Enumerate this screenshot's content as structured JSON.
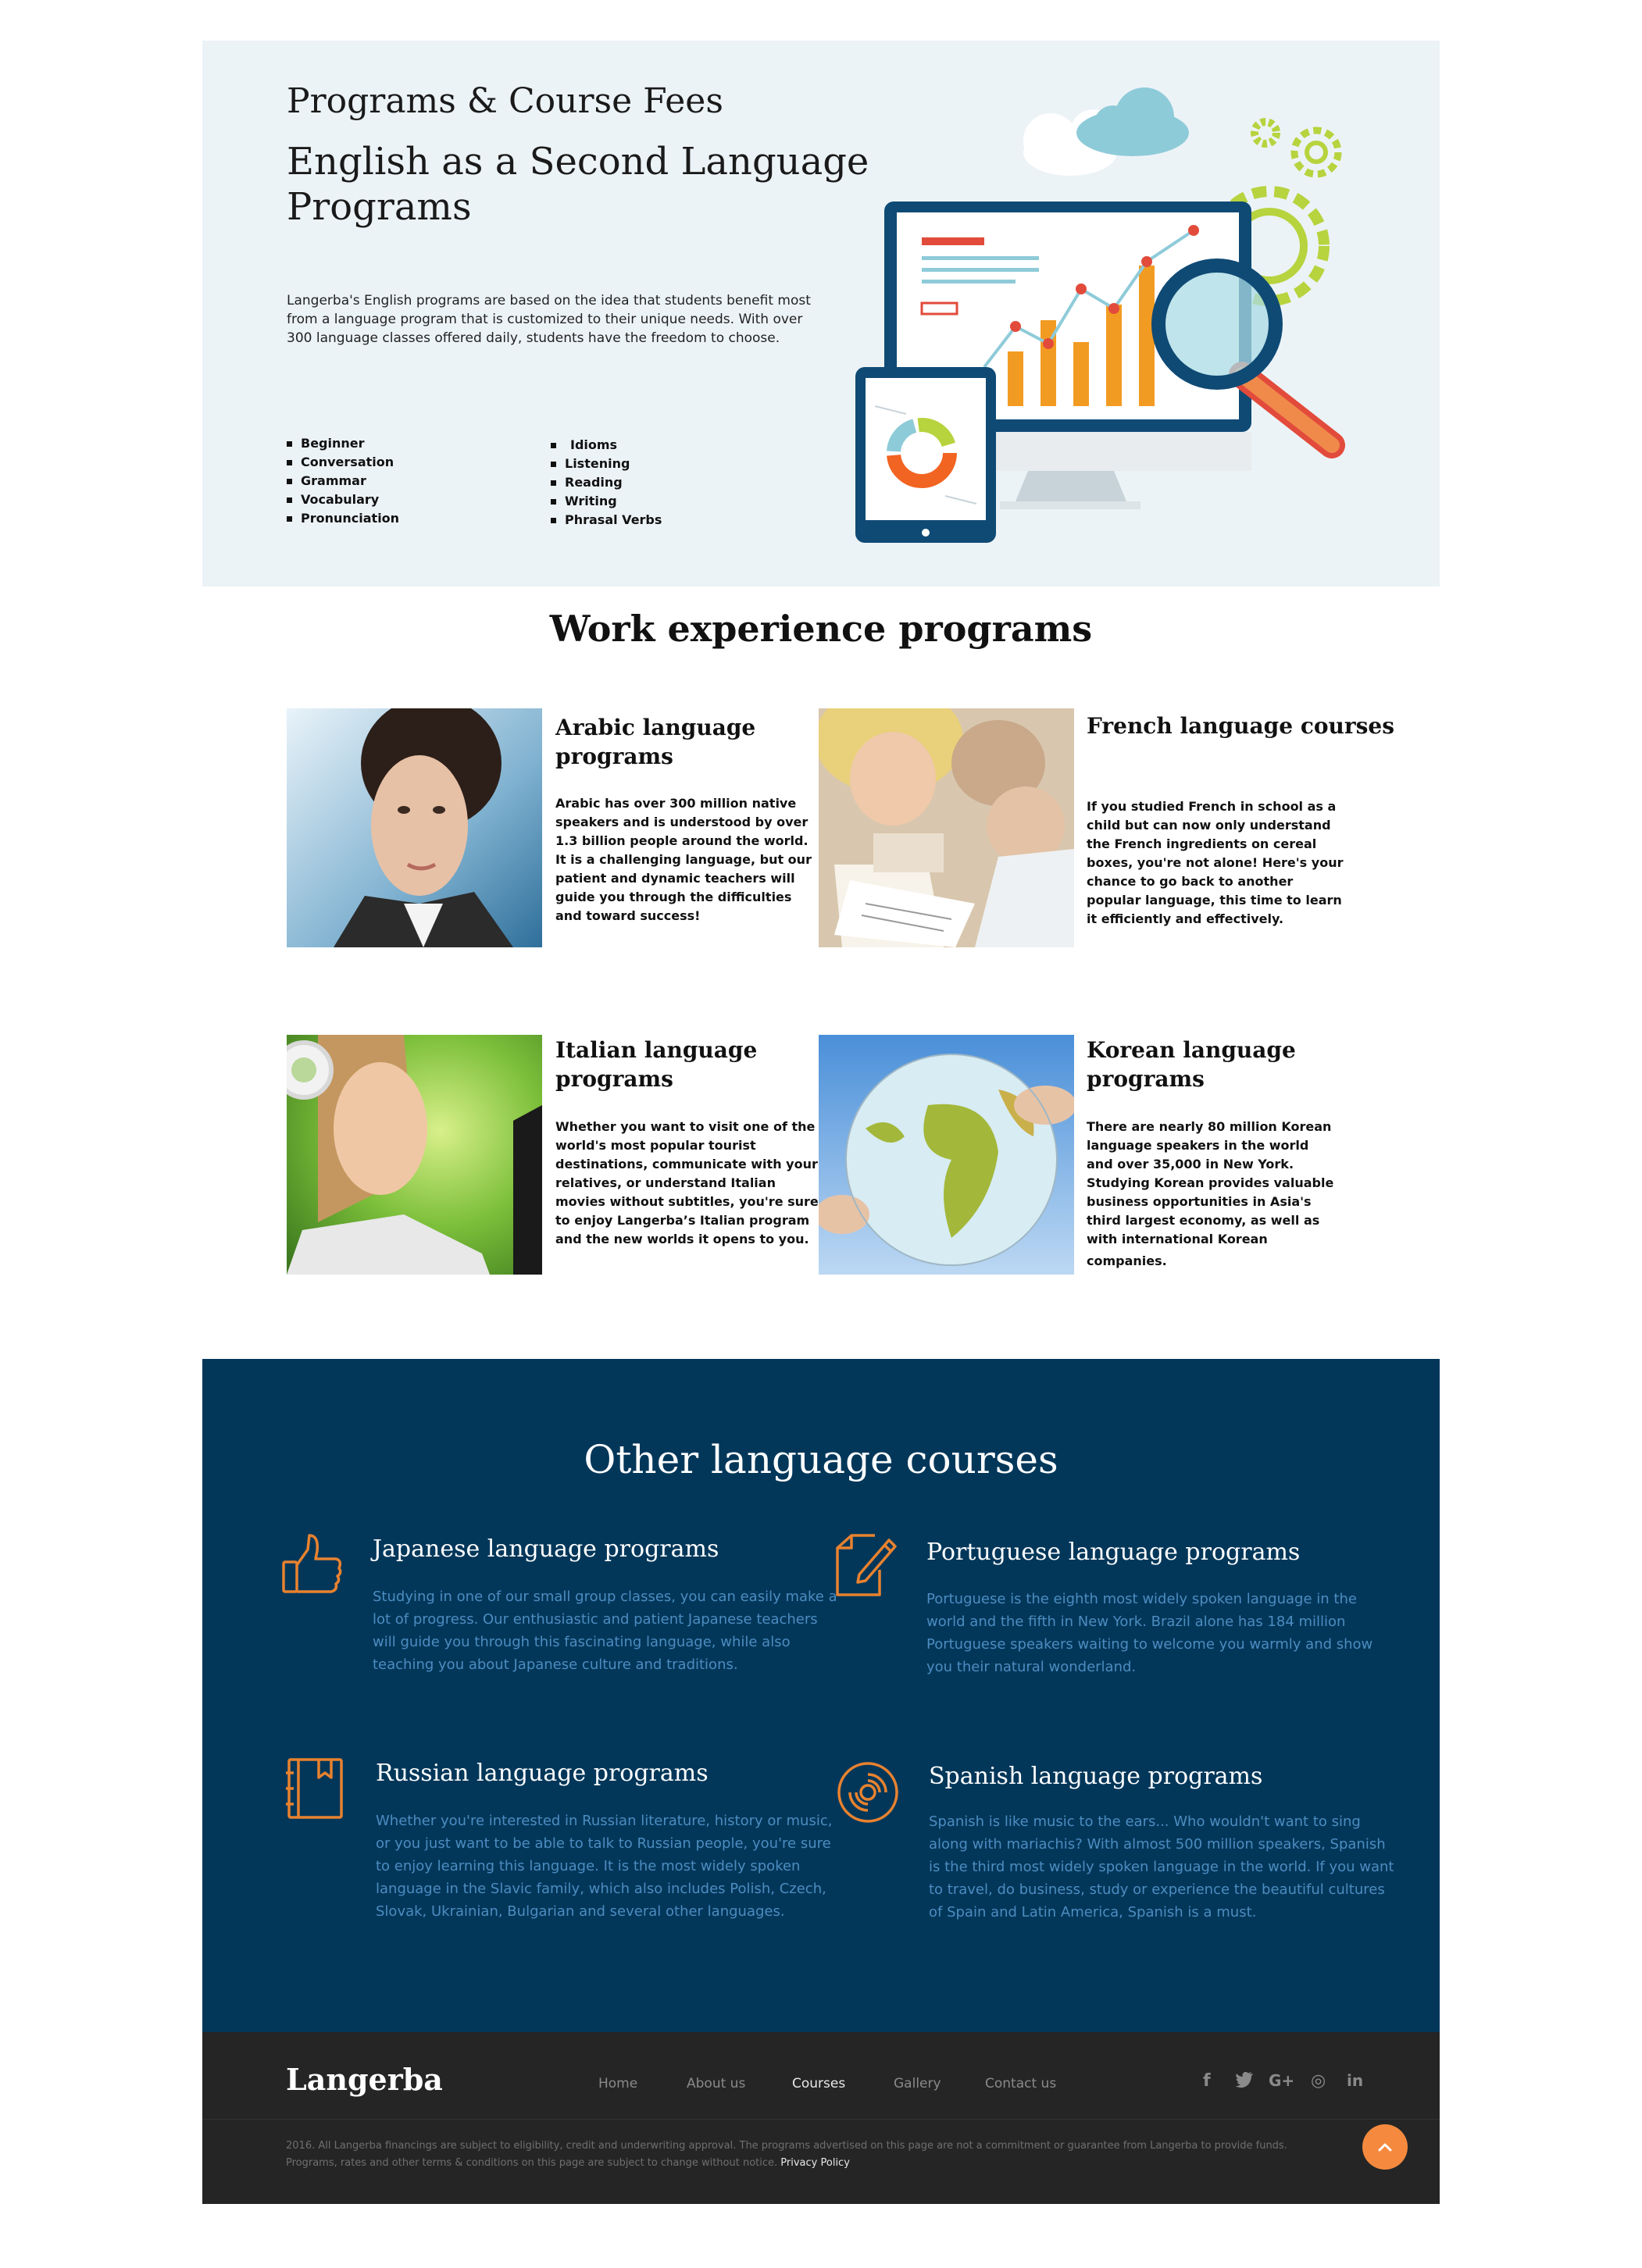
{
  "hero": {
    "title": "Programs & Course Fees",
    "subtitle_line1": "English as a Second Language",
    "subtitle_line2": "Programs",
    "body_line1": "Langerba's English programs are based on the idea that students benefit most",
    "body_line2": "from a language program that is customized to their unique needs. With over",
    "body_line3": "300 language classes offered daily, students have the freedom to choose.",
    "list_left": [
      "Beginner",
      "Conversation",
      "Grammar",
      "Vocabulary",
      "Pronunciation"
    ],
    "list_right": [
      "Idioms",
      "Listening",
      "Reading",
      "Writing",
      "Phrasal Verbs"
    ]
  },
  "work": {
    "heading": "Work experience programs",
    "cards": [
      {
        "title_lines": [
          "Arabic language",
          "programs"
        ],
        "body_lines": [
          "Arabic has over 300 million native",
          "speakers and is understood by over",
          "1.3 billion people around the world.",
          "It is a challenging language, but our",
          "patient and dynamic teachers will",
          "guide you through the difficulties",
          "and toward success!"
        ]
      },
      {
        "title_lines": [
          "French language courses"
        ],
        "body_lines": [
          "If you studied French in school as a",
          "child but can now only understand",
          "the French ingredients on cereal",
          "boxes, you're not alone! Here's your",
          "chance to go back to another",
          "popular language, this time to learn",
          "it efficiently and effectively."
        ]
      },
      {
        "title_lines": [
          "Italian language",
          "programs"
        ],
        "body_lines": [
          "Whether you want to visit one of the",
          "world's most popular tourist",
          "destinations, communicate with your",
          "relatives, or understand Italian",
          "movies without subtitles, you're sure",
          "to enjoy Langerba’s Italian program",
          "and the new worlds it opens to you."
        ]
      },
      {
        "title_lines": [
          "Korean language",
          "programs"
        ],
        "body_lines": [
          "There are nearly 80 million Korean",
          "language speakers in the world",
          "and over 35,000 in New York.",
          "Studying Korean provides valuable",
          "business opportunities in Asia's",
          "third largest economy, as well as",
          "with international Korean",
          "companies."
        ]
      }
    ]
  },
  "other": {
    "heading": "Other language courses",
    "features": [
      {
        "icon": "thumbs-up-icon",
        "title": "Japanese language programs",
        "body_lines": [
          "Studying in one of our small group classes, you can easily make a",
          "lot of progress. Our enthusiastic and patient Japanese teachers",
          "will guide you through this fascinating language, while also",
          "teaching you about Japanese culture and traditions."
        ]
      },
      {
        "icon": "edit-document-icon",
        "title": "Portuguese language programs",
        "body_lines": [
          "Portuguese is the eighth most widely spoken language in the",
          "world and the fifth in New York. Brazil alone has 184 million",
          "Portuguese speakers waiting to welcome you warmly and show",
          "you their natural wonderland."
        ]
      },
      {
        "icon": "book-icon",
        "title": "Russian language programs",
        "body_lines": [
          "Whether you're interested in Russian literature, history or music,",
          "or you just want to be able to talk to Russian people, you're sure",
          "to enjoy learning this language. It is the most widely spoken",
          "language in the Slavic family, which also includes Polish, Czech,",
          "Slovak, Ukrainian, Bulgarian and several other languages."
        ]
      },
      {
        "icon": "vinyl-disc-icon",
        "title": "Spanish language programs",
        "body_lines": [
          "Spanish is like music to the ears... Who wouldn't want to sing",
          "along with mariachis? With almost 500 million speakers, Spanish",
          "is the third most widely spoken language in the world. If you want",
          "to travel, do business, study or experience the beautiful cultures",
          "of Spain and Latin America, Spanish is a must."
        ]
      }
    ],
    "accent_color": "#e8822f",
    "background_color": "#02375a"
  },
  "footer": {
    "brand": "Langerba",
    "nav": [
      "Home",
      "About us",
      "Courses",
      "Gallery",
      "Contact us"
    ],
    "active_nav": "Courses",
    "social": [
      "f",
      "t",
      "G+",
      "◎",
      "in"
    ],
    "legal_line1": "2016. All Langerba financings are subject to eligibility, credit and underwriting approval. The programs advertised on this page are not a commitment or guarantee from Langerba to provide funds.",
    "legal_line2": "Programs, rates and other terms & conditions on this page are subject to change without notice.",
    "privacy": "Privacy Policy",
    "back_to_top_icon": "chevron-up-icon"
  }
}
